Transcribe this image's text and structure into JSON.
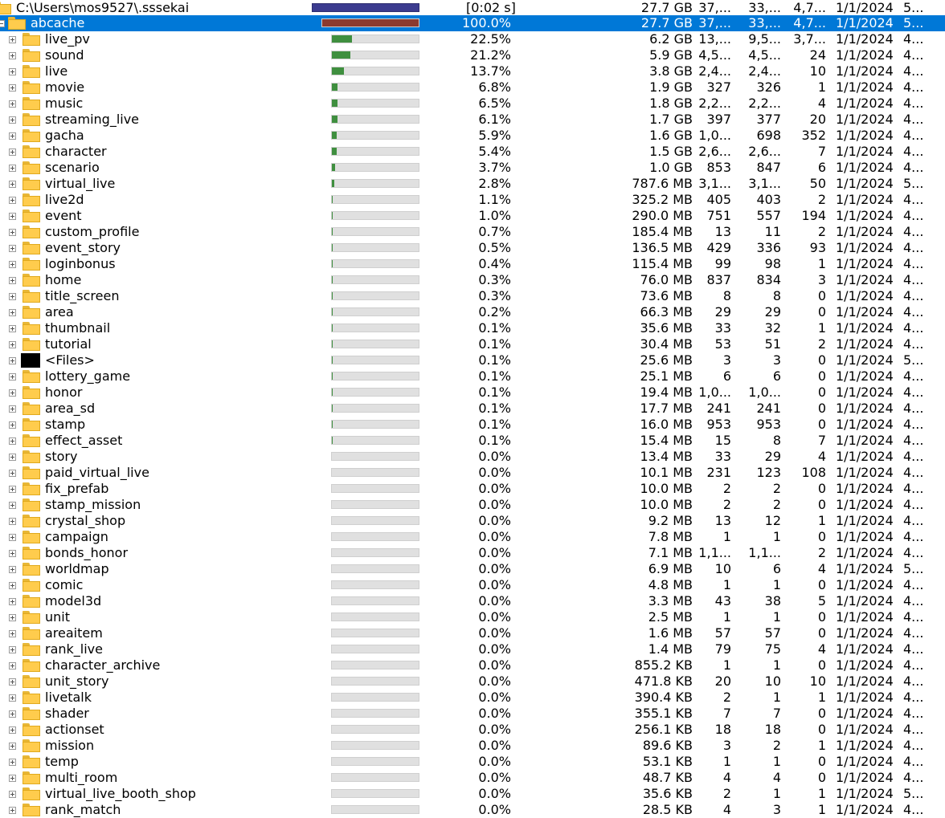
{
  "root": {
    "path": "C:\\Users\\mos9527\\.sssekai",
    "elapsed": "[0:02 s]",
    "size": "27.7 GB",
    "c1": "37,...",
    "c2": "33,...",
    "c3": "4,7...",
    "date": "1/1/2024",
    "last": "5..."
  },
  "selected": {
    "name": "abcache",
    "fraction": 1.0,
    "percent": "100.0%",
    "size": "27.7 GB",
    "c1": "37,...",
    "c2": "33,...",
    "c3": "4,7...",
    "date": "1/1/2024",
    "last": "5..."
  },
  "colors": {
    "root_bar": "#3b3b8f",
    "selected_bar": "#8b3a2f",
    "child_bar": "#3f8f3f",
    "selection": "#0078d7"
  },
  "rows": [
    {
      "name": "live_pv",
      "fraction": 0.225,
      "percent": "22.5%",
      "size": "6.2 GB",
      "c1": "13,...",
      "c2": "9,5...",
      "c3": "3,7...",
      "date": "1/1/2024",
      "last": "4..."
    },
    {
      "name": "sound",
      "fraction": 0.212,
      "percent": "21.2%",
      "size": "5.9 GB",
      "c1": "4,5...",
      "c2": "4,5...",
      "c3": "24",
      "date": "1/1/2024",
      "last": "4..."
    },
    {
      "name": "live",
      "fraction": 0.137,
      "percent": "13.7%",
      "size": "3.8 GB",
      "c1": "2,4...",
      "c2": "2,4...",
      "c3": "10",
      "date": "1/1/2024",
      "last": "4..."
    },
    {
      "name": "movie",
      "fraction": 0.068,
      "percent": "6.8%",
      "size": "1.9 GB",
      "c1": "327",
      "c2": "326",
      "c3": "1",
      "date": "1/1/2024",
      "last": "4..."
    },
    {
      "name": "music",
      "fraction": 0.065,
      "percent": "6.5%",
      "size": "1.8 GB",
      "c1": "2,2...",
      "c2": "2,2...",
      "c3": "4",
      "date": "1/1/2024",
      "last": "4..."
    },
    {
      "name": "streaming_live",
      "fraction": 0.061,
      "percent": "6.1%",
      "size": "1.7 GB",
      "c1": "397",
      "c2": "377",
      "c3": "20",
      "date": "1/1/2024",
      "last": "4..."
    },
    {
      "name": "gacha",
      "fraction": 0.059,
      "percent": "5.9%",
      "size": "1.6 GB",
      "c1": "1,0...",
      "c2": "698",
      "c3": "352",
      "date": "1/1/2024",
      "last": "4..."
    },
    {
      "name": "character",
      "fraction": 0.054,
      "percent": "5.4%",
      "size": "1.5 GB",
      "c1": "2,6...",
      "c2": "2,6...",
      "c3": "7",
      "date": "1/1/2024",
      "last": "4..."
    },
    {
      "name": "scenario",
      "fraction": 0.037,
      "percent": "3.7%",
      "size": "1.0 GB",
      "c1": "853",
      "c2": "847",
      "c3": "6",
      "date": "1/1/2024",
      "last": "4..."
    },
    {
      "name": "virtual_live",
      "fraction": 0.028,
      "percent": "2.8%",
      "size": "787.6 MB",
      "c1": "3,1...",
      "c2": "3,1...",
      "c3": "50",
      "date": "1/1/2024",
      "last": "5..."
    },
    {
      "name": "live2d",
      "fraction": 0.011,
      "percent": "1.1%",
      "size": "325.2 MB",
      "c1": "405",
      "c2": "403",
      "c3": "2",
      "date": "1/1/2024",
      "last": "4..."
    },
    {
      "name": "event",
      "fraction": 0.01,
      "percent": "1.0%",
      "size": "290.0 MB",
      "c1": "751",
      "c2": "557",
      "c3": "194",
      "date": "1/1/2024",
      "last": "4..."
    },
    {
      "name": "custom_profile",
      "fraction": 0.007,
      "percent": "0.7%",
      "size": "185.4 MB",
      "c1": "13",
      "c2": "11",
      "c3": "2",
      "date": "1/1/2024",
      "last": "4..."
    },
    {
      "name": "event_story",
      "fraction": 0.005,
      "percent": "0.5%",
      "size": "136.5 MB",
      "c1": "429",
      "c2": "336",
      "c3": "93",
      "date": "1/1/2024",
      "last": "4..."
    },
    {
      "name": "loginbonus",
      "fraction": 0.004,
      "percent": "0.4%",
      "size": "115.4 MB",
      "c1": "99",
      "c2": "98",
      "c3": "1",
      "date": "1/1/2024",
      "last": "4..."
    },
    {
      "name": "home",
      "fraction": 0.003,
      "percent": "0.3%",
      "size": "76.0 MB",
      "c1": "837",
      "c2": "834",
      "c3": "3",
      "date": "1/1/2024",
      "last": "4..."
    },
    {
      "name": "title_screen",
      "fraction": 0.003,
      "percent": "0.3%",
      "size": "73.6 MB",
      "c1": "8",
      "c2": "8",
      "c3": "0",
      "date": "1/1/2024",
      "last": "4..."
    },
    {
      "name": "area",
      "fraction": 0.002,
      "percent": "0.2%",
      "size": "66.3 MB",
      "c1": "29",
      "c2": "29",
      "c3": "0",
      "date": "1/1/2024",
      "last": "4..."
    },
    {
      "name": "thumbnail",
      "fraction": 0.001,
      "percent": "0.1%",
      "size": "35.6 MB",
      "c1": "33",
      "c2": "32",
      "c3": "1",
      "date": "1/1/2024",
      "last": "4..."
    },
    {
      "name": "tutorial",
      "fraction": 0.001,
      "percent": "0.1%",
      "size": "30.4 MB",
      "c1": "53",
      "c2": "51",
      "c3": "2",
      "date": "1/1/2024",
      "last": "4..."
    },
    {
      "name": "<Files>",
      "files": true,
      "fraction": 0.001,
      "percent": "0.1%",
      "size": "25.6 MB",
      "c1": "3",
      "c2": "3",
      "c3": "0",
      "date": "1/1/2024",
      "last": "5..."
    },
    {
      "name": "lottery_game",
      "fraction": 0.001,
      "percent": "0.1%",
      "size": "25.1 MB",
      "c1": "6",
      "c2": "6",
      "c3": "0",
      "date": "1/1/2024",
      "last": "4..."
    },
    {
      "name": "honor",
      "fraction": 0.001,
      "percent": "0.1%",
      "size": "19.4 MB",
      "c1": "1,0...",
      "c2": "1,0...",
      "c3": "0",
      "date": "1/1/2024",
      "last": "4..."
    },
    {
      "name": "area_sd",
      "fraction": 0.001,
      "percent": "0.1%",
      "size": "17.7 MB",
      "c1": "241",
      "c2": "241",
      "c3": "0",
      "date": "1/1/2024",
      "last": "4..."
    },
    {
      "name": "stamp",
      "fraction": 0.001,
      "percent": "0.1%",
      "size": "16.0 MB",
      "c1": "953",
      "c2": "953",
      "c3": "0",
      "date": "1/1/2024",
      "last": "4..."
    },
    {
      "name": "effect_asset",
      "fraction": 0.001,
      "percent": "0.1%",
      "size": "15.4 MB",
      "c1": "15",
      "c2": "8",
      "c3": "7",
      "date": "1/1/2024",
      "last": "4..."
    },
    {
      "name": "story",
      "fraction": 0.0,
      "percent": "0.0%",
      "size": "13.4 MB",
      "c1": "33",
      "c2": "29",
      "c3": "4",
      "date": "1/1/2024",
      "last": "4..."
    },
    {
      "name": "paid_virtual_live",
      "fraction": 0.0,
      "percent": "0.0%",
      "size": "10.1 MB",
      "c1": "231",
      "c2": "123",
      "c3": "108",
      "date": "1/1/2024",
      "last": "4..."
    },
    {
      "name": "fix_prefab",
      "fraction": 0.0,
      "percent": "0.0%",
      "size": "10.0 MB",
      "c1": "2",
      "c2": "2",
      "c3": "0",
      "date": "1/1/2024",
      "last": "4..."
    },
    {
      "name": "stamp_mission",
      "fraction": 0.0,
      "percent": "0.0%",
      "size": "10.0 MB",
      "c1": "2",
      "c2": "2",
      "c3": "0",
      "date": "1/1/2024",
      "last": "4..."
    },
    {
      "name": "crystal_shop",
      "fraction": 0.0,
      "percent": "0.0%",
      "size": "9.2 MB",
      "c1": "13",
      "c2": "12",
      "c3": "1",
      "date": "1/1/2024",
      "last": "4..."
    },
    {
      "name": "campaign",
      "fraction": 0.0,
      "percent": "0.0%",
      "size": "7.8 MB",
      "c1": "1",
      "c2": "1",
      "c3": "0",
      "date": "1/1/2024",
      "last": "4..."
    },
    {
      "name": "bonds_honor",
      "fraction": 0.0,
      "percent": "0.0%",
      "size": "7.1 MB",
      "c1": "1,1...",
      "c2": "1,1...",
      "c3": "2",
      "date": "1/1/2024",
      "last": "4..."
    },
    {
      "name": "worldmap",
      "fraction": 0.0,
      "percent": "0.0%",
      "size": "6.9 MB",
      "c1": "10",
      "c2": "6",
      "c3": "4",
      "date": "1/1/2024",
      "last": "5..."
    },
    {
      "name": "comic",
      "fraction": 0.0,
      "percent": "0.0%",
      "size": "4.8 MB",
      "c1": "1",
      "c2": "1",
      "c3": "0",
      "date": "1/1/2024",
      "last": "4..."
    },
    {
      "name": "model3d",
      "fraction": 0.0,
      "percent": "0.0%",
      "size": "3.3 MB",
      "c1": "43",
      "c2": "38",
      "c3": "5",
      "date": "1/1/2024",
      "last": "4..."
    },
    {
      "name": "unit",
      "fraction": 0.0,
      "percent": "0.0%",
      "size": "2.5 MB",
      "c1": "1",
      "c2": "1",
      "c3": "0",
      "date": "1/1/2024",
      "last": "4..."
    },
    {
      "name": "areaitem",
      "fraction": 0.0,
      "percent": "0.0%",
      "size": "1.6 MB",
      "c1": "57",
      "c2": "57",
      "c3": "0",
      "date": "1/1/2024",
      "last": "4..."
    },
    {
      "name": "rank_live",
      "fraction": 0.0,
      "percent": "0.0%",
      "size": "1.4 MB",
      "c1": "79",
      "c2": "75",
      "c3": "4",
      "date": "1/1/2024",
      "last": "4..."
    },
    {
      "name": "character_archive",
      "fraction": 0.0,
      "percent": "0.0%",
      "size": "855.2 KB",
      "c1": "1",
      "c2": "1",
      "c3": "0",
      "date": "1/1/2024",
      "last": "4..."
    },
    {
      "name": "unit_story",
      "fraction": 0.0,
      "percent": "0.0%",
      "size": "471.8 KB",
      "c1": "20",
      "c2": "10",
      "c3": "10",
      "date": "1/1/2024",
      "last": "4..."
    },
    {
      "name": "livetalk",
      "fraction": 0.0,
      "percent": "0.0%",
      "size": "390.4 KB",
      "c1": "2",
      "c2": "1",
      "c3": "1",
      "date": "1/1/2024",
      "last": "4..."
    },
    {
      "name": "shader",
      "fraction": 0.0,
      "percent": "0.0%",
      "size": "355.1 KB",
      "c1": "7",
      "c2": "7",
      "c3": "0",
      "date": "1/1/2024",
      "last": "4..."
    },
    {
      "name": "actionset",
      "fraction": 0.0,
      "percent": "0.0%",
      "size": "256.1 KB",
      "c1": "18",
      "c2": "18",
      "c3": "0",
      "date": "1/1/2024",
      "last": "4..."
    },
    {
      "name": "mission",
      "fraction": 0.0,
      "percent": "0.0%",
      "size": "89.6 KB",
      "c1": "3",
      "c2": "2",
      "c3": "1",
      "date": "1/1/2024",
      "last": "4..."
    },
    {
      "name": "temp",
      "fraction": 0.0,
      "percent": "0.0%",
      "size": "53.1 KB",
      "c1": "1",
      "c2": "1",
      "c3": "0",
      "date": "1/1/2024",
      "last": "4..."
    },
    {
      "name": "multi_room",
      "fraction": 0.0,
      "percent": "0.0%",
      "size": "48.7 KB",
      "c1": "4",
      "c2": "4",
      "c3": "0",
      "date": "1/1/2024",
      "last": "4..."
    },
    {
      "name": "virtual_live_booth_shop",
      "fraction": 0.0,
      "percent": "0.0%",
      "size": "35.6 KB",
      "c1": "2",
      "c2": "1",
      "c3": "1",
      "date": "1/1/2024",
      "last": "5..."
    },
    {
      "name": "rank_match",
      "fraction": 0.0,
      "percent": "0.0%",
      "size": "28.5 KB",
      "c1": "4",
      "c2": "3",
      "c3": "1",
      "date": "1/1/2024",
      "last": "4..."
    }
  ]
}
